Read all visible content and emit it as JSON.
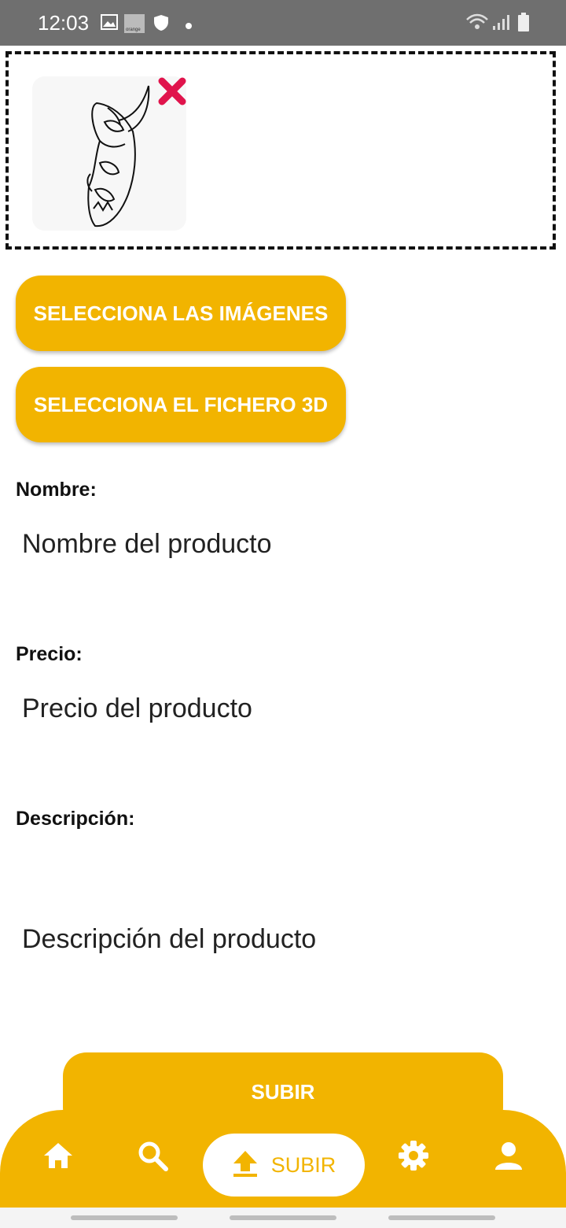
{
  "status_bar": {
    "time": "12:03",
    "left_icons": [
      "image-icon",
      "carrier-icon",
      "shield-icon",
      "dot-icon"
    ],
    "carrier_text": "orange",
    "right_icons": [
      "wifi-icon",
      "signal-icon",
      "battery-icon"
    ]
  },
  "images": {
    "remove_icon": "close-icon",
    "remove_color": "#e0144c"
  },
  "buttons": {
    "select_images": "SELECCIONA LAS IMÁGENES",
    "select_3d": "SELECCIONA EL FICHERO 3D",
    "submit": "SUBIR"
  },
  "form": {
    "name_label": "Nombre:",
    "name_placeholder": "Nombre del producto",
    "price_label": "Precio:",
    "price_placeholder": "Precio del producto",
    "description_label": "Descripción:",
    "description_placeholder": "Descripción del producto"
  },
  "bottom_nav": {
    "items": [
      {
        "icon": "home-icon"
      },
      {
        "icon": "search-icon"
      },
      {
        "icon": "upload-icon",
        "label": "SUBIR",
        "active": true
      },
      {
        "icon": "gear-icon"
      },
      {
        "icon": "user-icon"
      }
    ]
  },
  "colors": {
    "accent": "#f2b400",
    "status_bar": "#6f6f6f",
    "remove": "#e0144c"
  }
}
